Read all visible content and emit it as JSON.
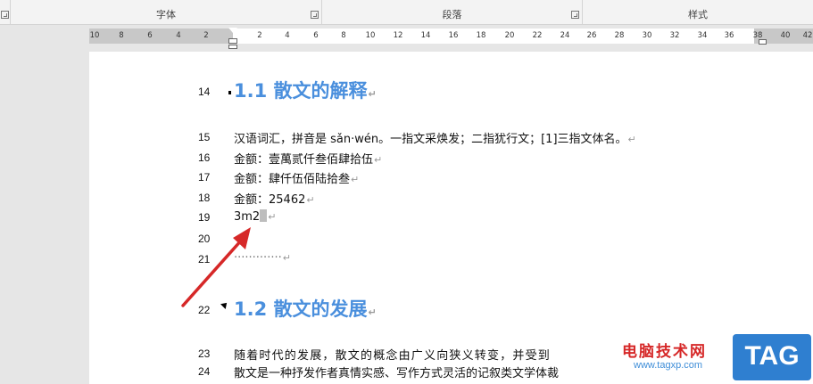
{
  "ribbon": {
    "groups": [
      {
        "label": "字体"
      },
      {
        "label": "段落"
      },
      {
        "label": "样式"
      }
    ]
  },
  "ruler": {
    "ticks_left": [
      "10",
      "8",
      "6",
      "4",
      "2"
    ],
    "ticks_right": [
      "2",
      "4",
      "6",
      "8",
      "10",
      "12",
      "14",
      "16",
      "18",
      "20",
      "22",
      "24",
      "26",
      "28",
      "30",
      "32",
      "34",
      "36",
      "38",
      "40",
      "42"
    ]
  },
  "document": {
    "line_numbers": [
      "14",
      "15",
      "16",
      "17",
      "18",
      "19",
      "20",
      "21",
      "22",
      "23",
      "24"
    ],
    "heading1": "1.1 散文的解释",
    "lines": {
      "l15": "汉语词汇，拼音是 sǎn·wén。一指文采焕发；二指犹行文；[1]三指文体名。",
      "l16": "金额：壹萬贰仟叁佰肆拾伍",
      "l17": "金额：肆仟伍佰陆拾叁",
      "l18": "金额：25462",
      "l19": "3m2",
      "l21": "·············"
    },
    "heading2": "1.2 散文的发展",
    "para23": "随着时代的发展，散文的概念由广义向狭义转变，并受到",
    "para24": "散文是一种抒发作者真情实感、写作方式灵活的记叙类文学体裁",
    "para_mark": "↵"
  },
  "watermark": {
    "brand": "电脑技术网",
    "url": "www.tagxp.com",
    "tag": "TAG"
  },
  "colors": {
    "heading": "#4a8fdd",
    "arrow": "#d62828",
    "watermark_tag": "#2f7fd0"
  }
}
